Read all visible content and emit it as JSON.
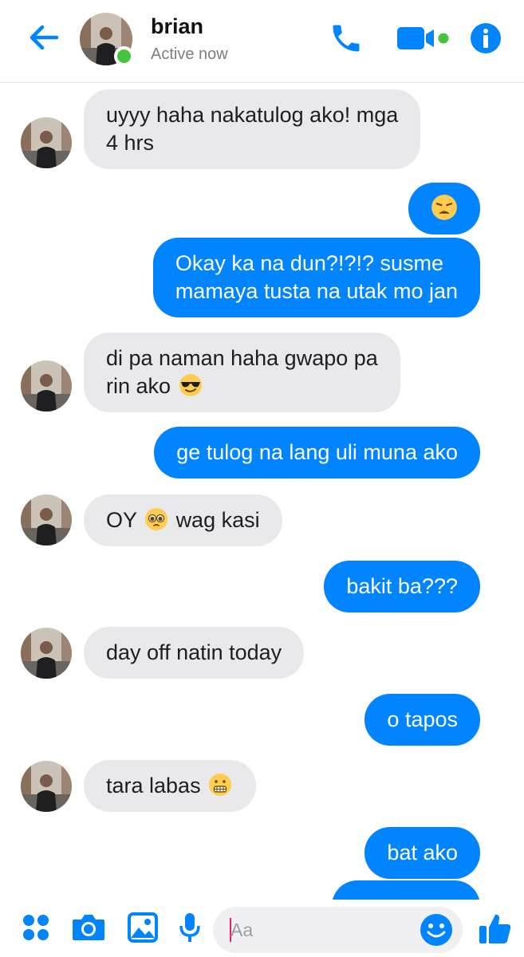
{
  "header": {
    "contact_name": "brian",
    "status": "Active now"
  },
  "composer": {
    "placeholder": "Aa"
  },
  "messages": [
    {
      "side": "in",
      "lines": [
        "uyyy haha nakatulog ako! mga",
        "4 hrs"
      ]
    },
    {
      "side": "out",
      "text": "",
      "emoji": "weary-face"
    },
    {
      "side": "out",
      "lines": [
        "Okay ka na dun?!?!? susme",
        "mamaya tusta na utak mo jan"
      ]
    },
    {
      "side": "in",
      "lines": [
        "di pa naman haha gwapo pa",
        "rin ako"
      ],
      "emoji": "sunglasses-face"
    },
    {
      "side": "out",
      "text": "ge tulog na lang uli muna ako"
    },
    {
      "side": "in",
      "text_before": "OY",
      "text_after": "wag kasi",
      "emoji": "pleading-face"
    },
    {
      "side": "out",
      "text": "bakit ba???"
    },
    {
      "side": "in",
      "text": "day off natin today"
    },
    {
      "side": "out",
      "text": "o tapos"
    },
    {
      "side": "in",
      "text": "tara labas",
      "emoji": "grimacing-face"
    },
    {
      "side": "out",
      "text": "bat ako"
    }
  ],
  "colors": {
    "accent": "#0084ff",
    "incoming_bubble": "#e9e9eb",
    "online": "#44c53c"
  }
}
